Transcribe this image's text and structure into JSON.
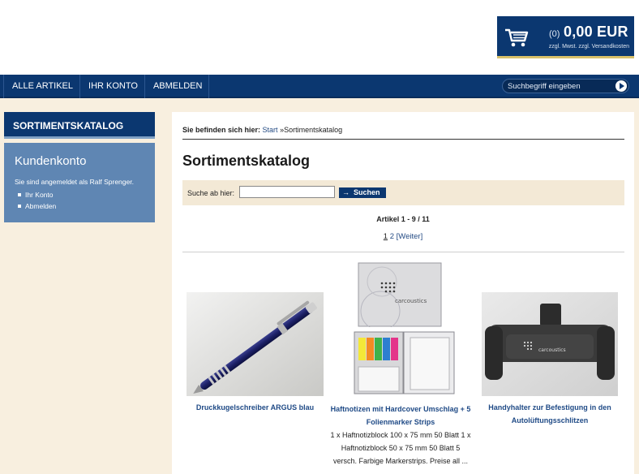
{
  "cart": {
    "count": "(0)",
    "amount": "0,00 EUR",
    "note": "zzgl. Mwst. zzgl. Versandkosten"
  },
  "nav": {
    "items": [
      "ALLE ARTIKEL",
      "IHR KONTO",
      "ABMELDEN"
    ],
    "search_placeholder": "Suchbegriff eingeben"
  },
  "sidebar": {
    "catalog_label": "SORTIMENTSKATALOG",
    "account": {
      "title": "Kundenkonto",
      "text": "Sie sind angemeldet als Ralf Sprenger.",
      "links": [
        "Ihr Konto",
        "Abmelden"
      ]
    }
  },
  "breadcrumb": {
    "prefix": "Sie befinden sich hier:",
    "start": "Start",
    "separator": "»",
    "current": "Sortimentskatalog"
  },
  "page_title": "Sortimentskatalog",
  "search": {
    "label": "Suche ab hier:",
    "value": "",
    "button": "Suchen"
  },
  "listing": {
    "count": "Artikel 1 - 9 / 11",
    "pages": [
      "1",
      "2"
    ],
    "next": "[Weiter]"
  },
  "products": [
    {
      "title": "Druckkugelschreiber ARGUS blau"
    },
    {
      "title": "Haftnotizen mit Hardcover Umschlag + 5 Folienmarker Strips",
      "description": "1 x Haftnotizblock 100 x 75 mm 50 Blatt 1 x Haftnotizblock 50 x 75 mm 50 Blatt 5 versch. Farbige Markerstrips. Preise all ..."
    },
    {
      "title": "Handyhalter zur Befestigung in den Autolüftungsschlitzen"
    }
  ],
  "brand_print": "carcoustics",
  "colors": {
    "primary": "#0b3770",
    "sidebar_account": "#5f86b3",
    "page_bg": "#f8efdf",
    "search_bar_bg": "#f3e9d6"
  }
}
